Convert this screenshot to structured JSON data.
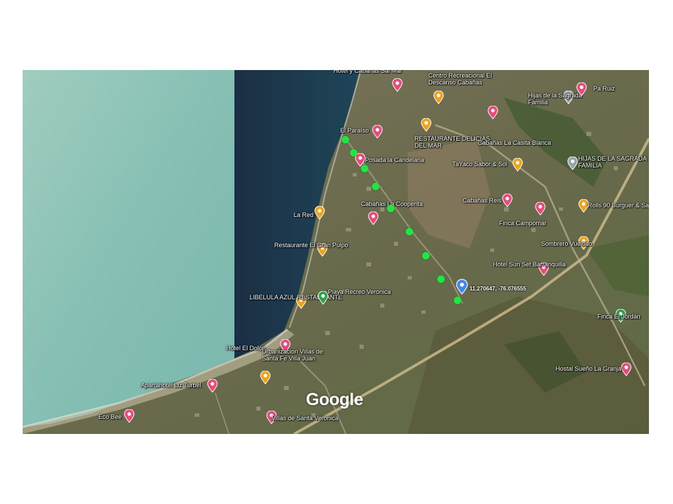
{
  "map": {
    "brand": "Google",
    "coordinates": "11.270647, -76.076555",
    "colors": {
      "sea_light": "#8fc3b6",
      "sea_dark": "#1a3448",
      "land": "#6f6a4f",
      "route_dot": "#1ee83f",
      "pin_lodging": "#e94a7a",
      "pin_food": "#f0a21b",
      "pin_place": "#9aa3ad",
      "pin_park": "#2fa24e",
      "pin_selected": "#4285f4"
    },
    "places": [
      {
        "label": "Hotel y Cabañas Sal Mar",
        "icon": "lodging-pin-icon"
      },
      {
        "label": "Centro Recreacional El Descanso Cabañas",
        "icon": "food-pin-icon"
      },
      {
        "label": "Hijas de la Sagrada Familia",
        "icon": "place-pin-icon"
      },
      {
        "label": "Pa Ruiz",
        "icon": "lodging-pin-icon"
      },
      {
        "label": "El Paraíso",
        "icon": "lodging-pin-icon"
      },
      {
        "label": "RESTAURANTE DELICIAS DEL MAR",
        "icon": "food-pin-icon"
      },
      {
        "label": "Cabañas La Casita Blanca",
        "icon": "lodging-pin-icon"
      },
      {
        "label": "Posada la Candelaria",
        "icon": "lodging-pin-icon"
      },
      {
        "label": "TaYaco Sabor & Sol",
        "icon": "food-pin-icon"
      },
      {
        "label": "HIJAS DE LA SAGRADA FAMILIA",
        "icon": "place-pin-icon"
      },
      {
        "label": "Cabañas La Cooperita",
        "icon": "lodging-pin-icon"
      },
      {
        "label": "Cabañas Reis",
        "icon": "lodging-pin-icon"
      },
      {
        "label": "Rolls 90 Burguer & Sal",
        "icon": "food-pin-icon"
      },
      {
        "label": "La Red",
        "icon": "food-pin-icon"
      },
      {
        "label": "Finca Campomar",
        "icon": "lodging-pin-icon"
      },
      {
        "label": "Restaurante El Gran Pulpo",
        "icon": "food-pin-icon"
      },
      {
        "label": "Sombrero Vueltiao",
        "icon": "food-pin-icon"
      },
      {
        "label": "Hotel Sun Set Barranquilla",
        "icon": "lodging-pin-icon"
      },
      {
        "label": "LIBELULA AZUL RESTAURANTE",
        "icon": "food-pin-icon"
      },
      {
        "label": "Playa Recreo Veronica",
        "icon": "park-pin-icon"
      },
      {
        "label": "Finca El Jordán",
        "icon": "park-pin-icon"
      },
      {
        "label": "Hotel El Dolce",
        "icon": "lodging-pin-icon"
      },
      {
        "label": "Urbanizacion Villas de Santa Fe Villa Juan",
        "icon": "food-pin-icon"
      },
      {
        "label": "Apartahotel Liz Turbel",
        "icon": "lodging-pin-icon"
      },
      {
        "label": "Hostal Sueño La Granja",
        "icon": "lodging-pin-icon"
      },
      {
        "label": "Eco Bee",
        "icon": "lodging-pin-icon"
      },
      {
        "label": "Villas de Santa Veronica",
        "icon": "lodging-pin-icon"
      }
    ]
  }
}
